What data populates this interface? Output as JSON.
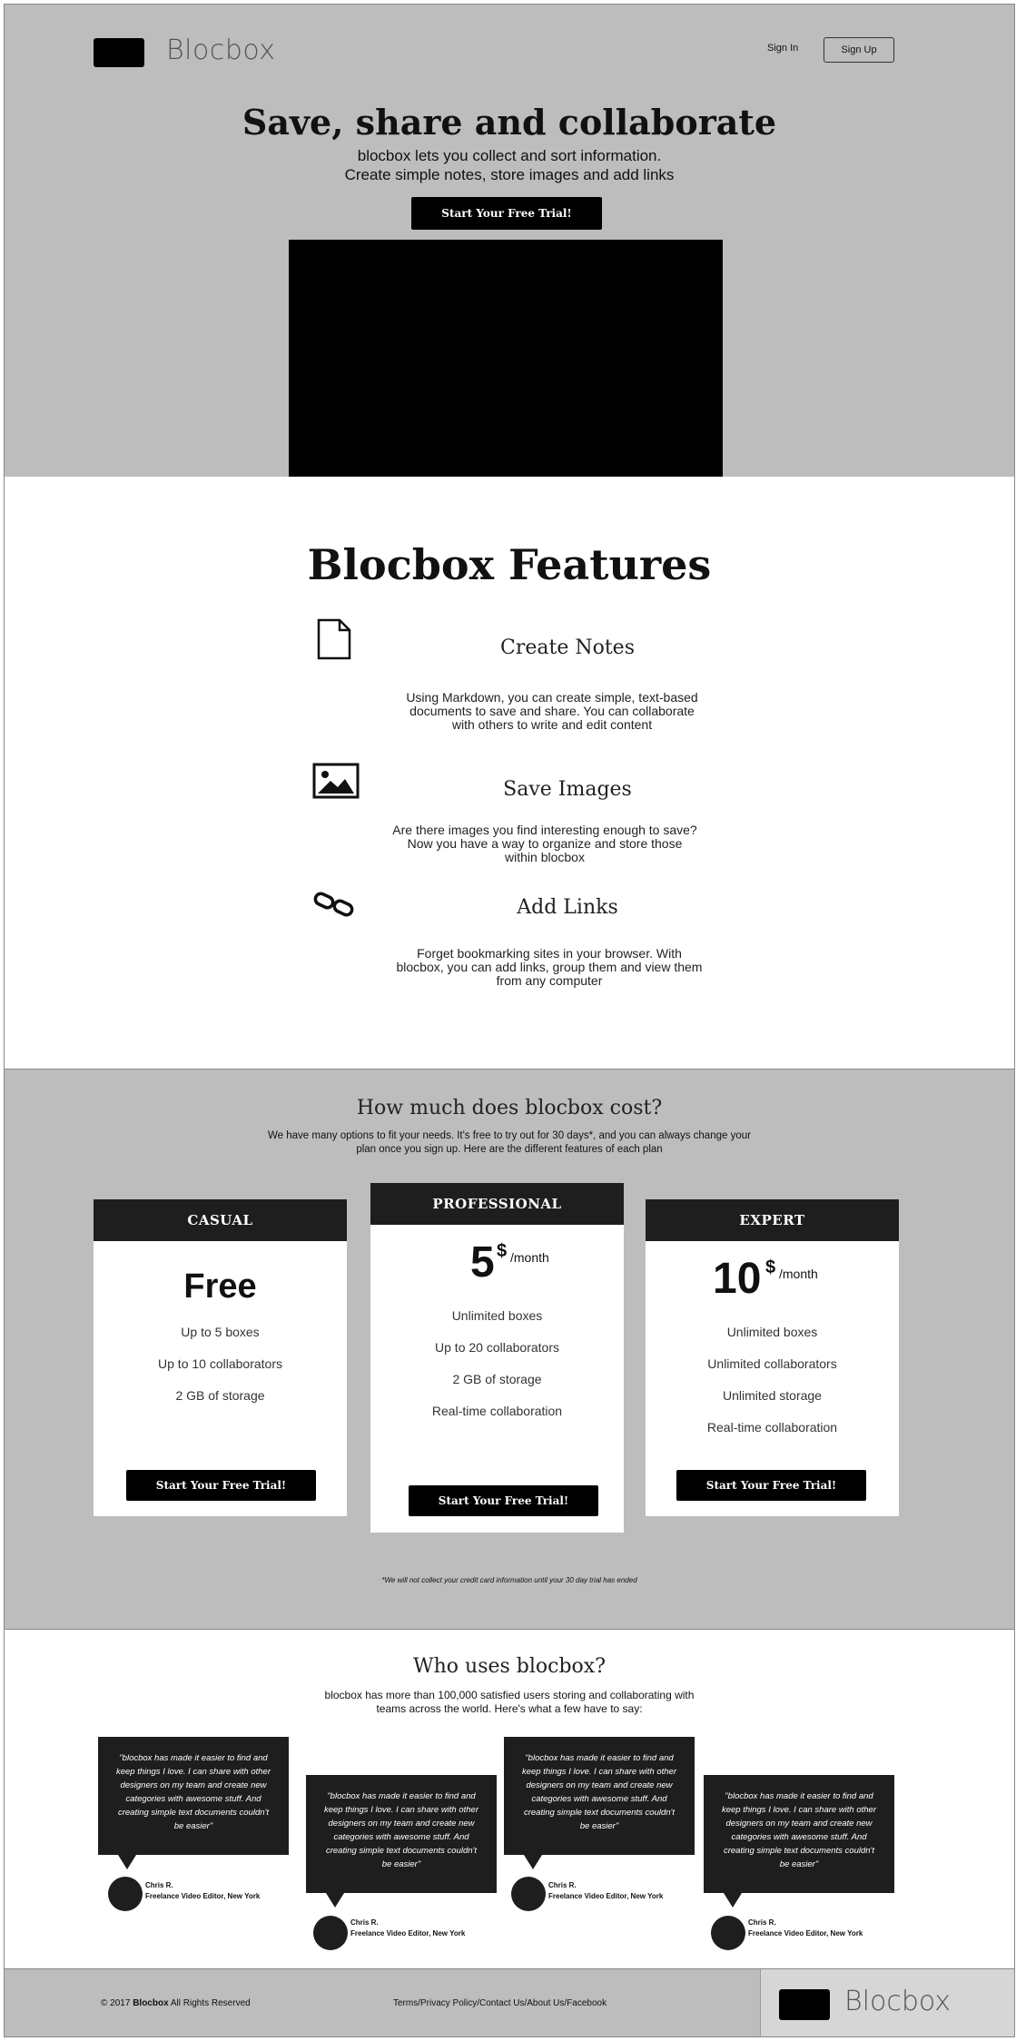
{
  "header": {
    "logo_text": "Blocbox",
    "sign_in": "Sign In",
    "sign_up": "Sign Up"
  },
  "hero": {
    "title": "Save, share and collaborate",
    "subtitle_line1": "blocbox lets you collect and sort information.",
    "subtitle_line2": "Create simple notes, store images and add links",
    "cta": "Start Your Free Trial!"
  },
  "features": {
    "title": "Blocbox Features",
    "items": [
      {
        "name": "Create Notes",
        "icon": "document-icon",
        "desc": "Using Markdown, you can create simple, text-based documents to save and share. You can collaborate with others to write and edit content"
      },
      {
        "name": "Save Images",
        "icon": "image-icon",
        "desc": "Are there images you find interesting enough to save? Now you have a way to organize and store those within blocbox"
      },
      {
        "name": "Add Links",
        "icon": "link-icon",
        "desc": "Forget bookmarking sites in your browser. With blocbox, you can add links, group them and view them from any computer"
      }
    ]
  },
  "pricing": {
    "title": "How much does blocbox cost?",
    "subtitle": "We have many options to fit your needs. It's free to try out for 30 days*, and you can always change your plan once you sign up. Here are the different features of each plan",
    "plans": [
      {
        "name": "CASUAL",
        "price": "Free",
        "features": [
          "Up to 5 boxes",
          "Up to 10 collaborators",
          "2 GB of storage"
        ],
        "cta": "Start Your Free Trial!"
      },
      {
        "name": "PROFESSIONAL",
        "price": "5",
        "currency": "$",
        "period": "/month",
        "features": [
          "Unlimited boxes",
          "Up to 20 collaborators",
          "2 GB of storage",
          "Real-time collaboration"
        ],
        "cta": "Start Your Free Trial!"
      },
      {
        "name": "EXPERT",
        "price": "10",
        "currency": "$",
        "period": "/month",
        "features": [
          "Unlimited boxes",
          "Unlimited collaborators",
          "Unlimited storage",
          "Real-time collaboration"
        ],
        "cta": "Start Your Free Trial!"
      }
    ],
    "note": "*We will not collect your credit card information until your 30 day trial has ended"
  },
  "testimonials": {
    "title": "Who uses blocbox?",
    "subtitle": "blocbox has more than 100,000 satisfied users storing and collaborating with teams across the world. Here's what a few have to say:",
    "items": [
      {
        "quote": "\"blocbox has made it easier to find and keep things I love. I can share with other designers on my team and create new categories with awesome stuff. And creating simple text documents couldn't be easier\"",
        "name": "Chris R.",
        "role": "Freelance Video Editor, New York"
      },
      {
        "quote": "\"blocbox has made it easier to find and keep things I love. I can share with other designers on my team and create new categories with awesome stuff. And creating simple text documents couldn't be easier\"",
        "name": "Chris R.",
        "role": "Freelance Video Editor, New York"
      },
      {
        "quote": "\"blocbox has made it easier to find and keep things I love. I can share with other designers on my team and create new categories with awesome stuff. And creating simple text documents couldn't be easier\"",
        "name": "Chris R.",
        "role": "Freelance Video Editor, New York"
      },
      {
        "quote": "\"blocbox has made it easier to find and keep things I love. I can share with other designers on my team and create new categories with awesome stuff. And creating simple text documents couldn't be easier\"",
        "name": "Chris R.",
        "role": "Freelance Video Editor, New York"
      }
    ]
  },
  "footer": {
    "copyright_prefix": "© 2017",
    "brand": "Blocbox",
    "copyright_suffix": "All Rights Reserved",
    "links": "Terms/Privacy Policy/Contact Us/About Us/Facebook",
    "logo_text": "Blocbox"
  }
}
